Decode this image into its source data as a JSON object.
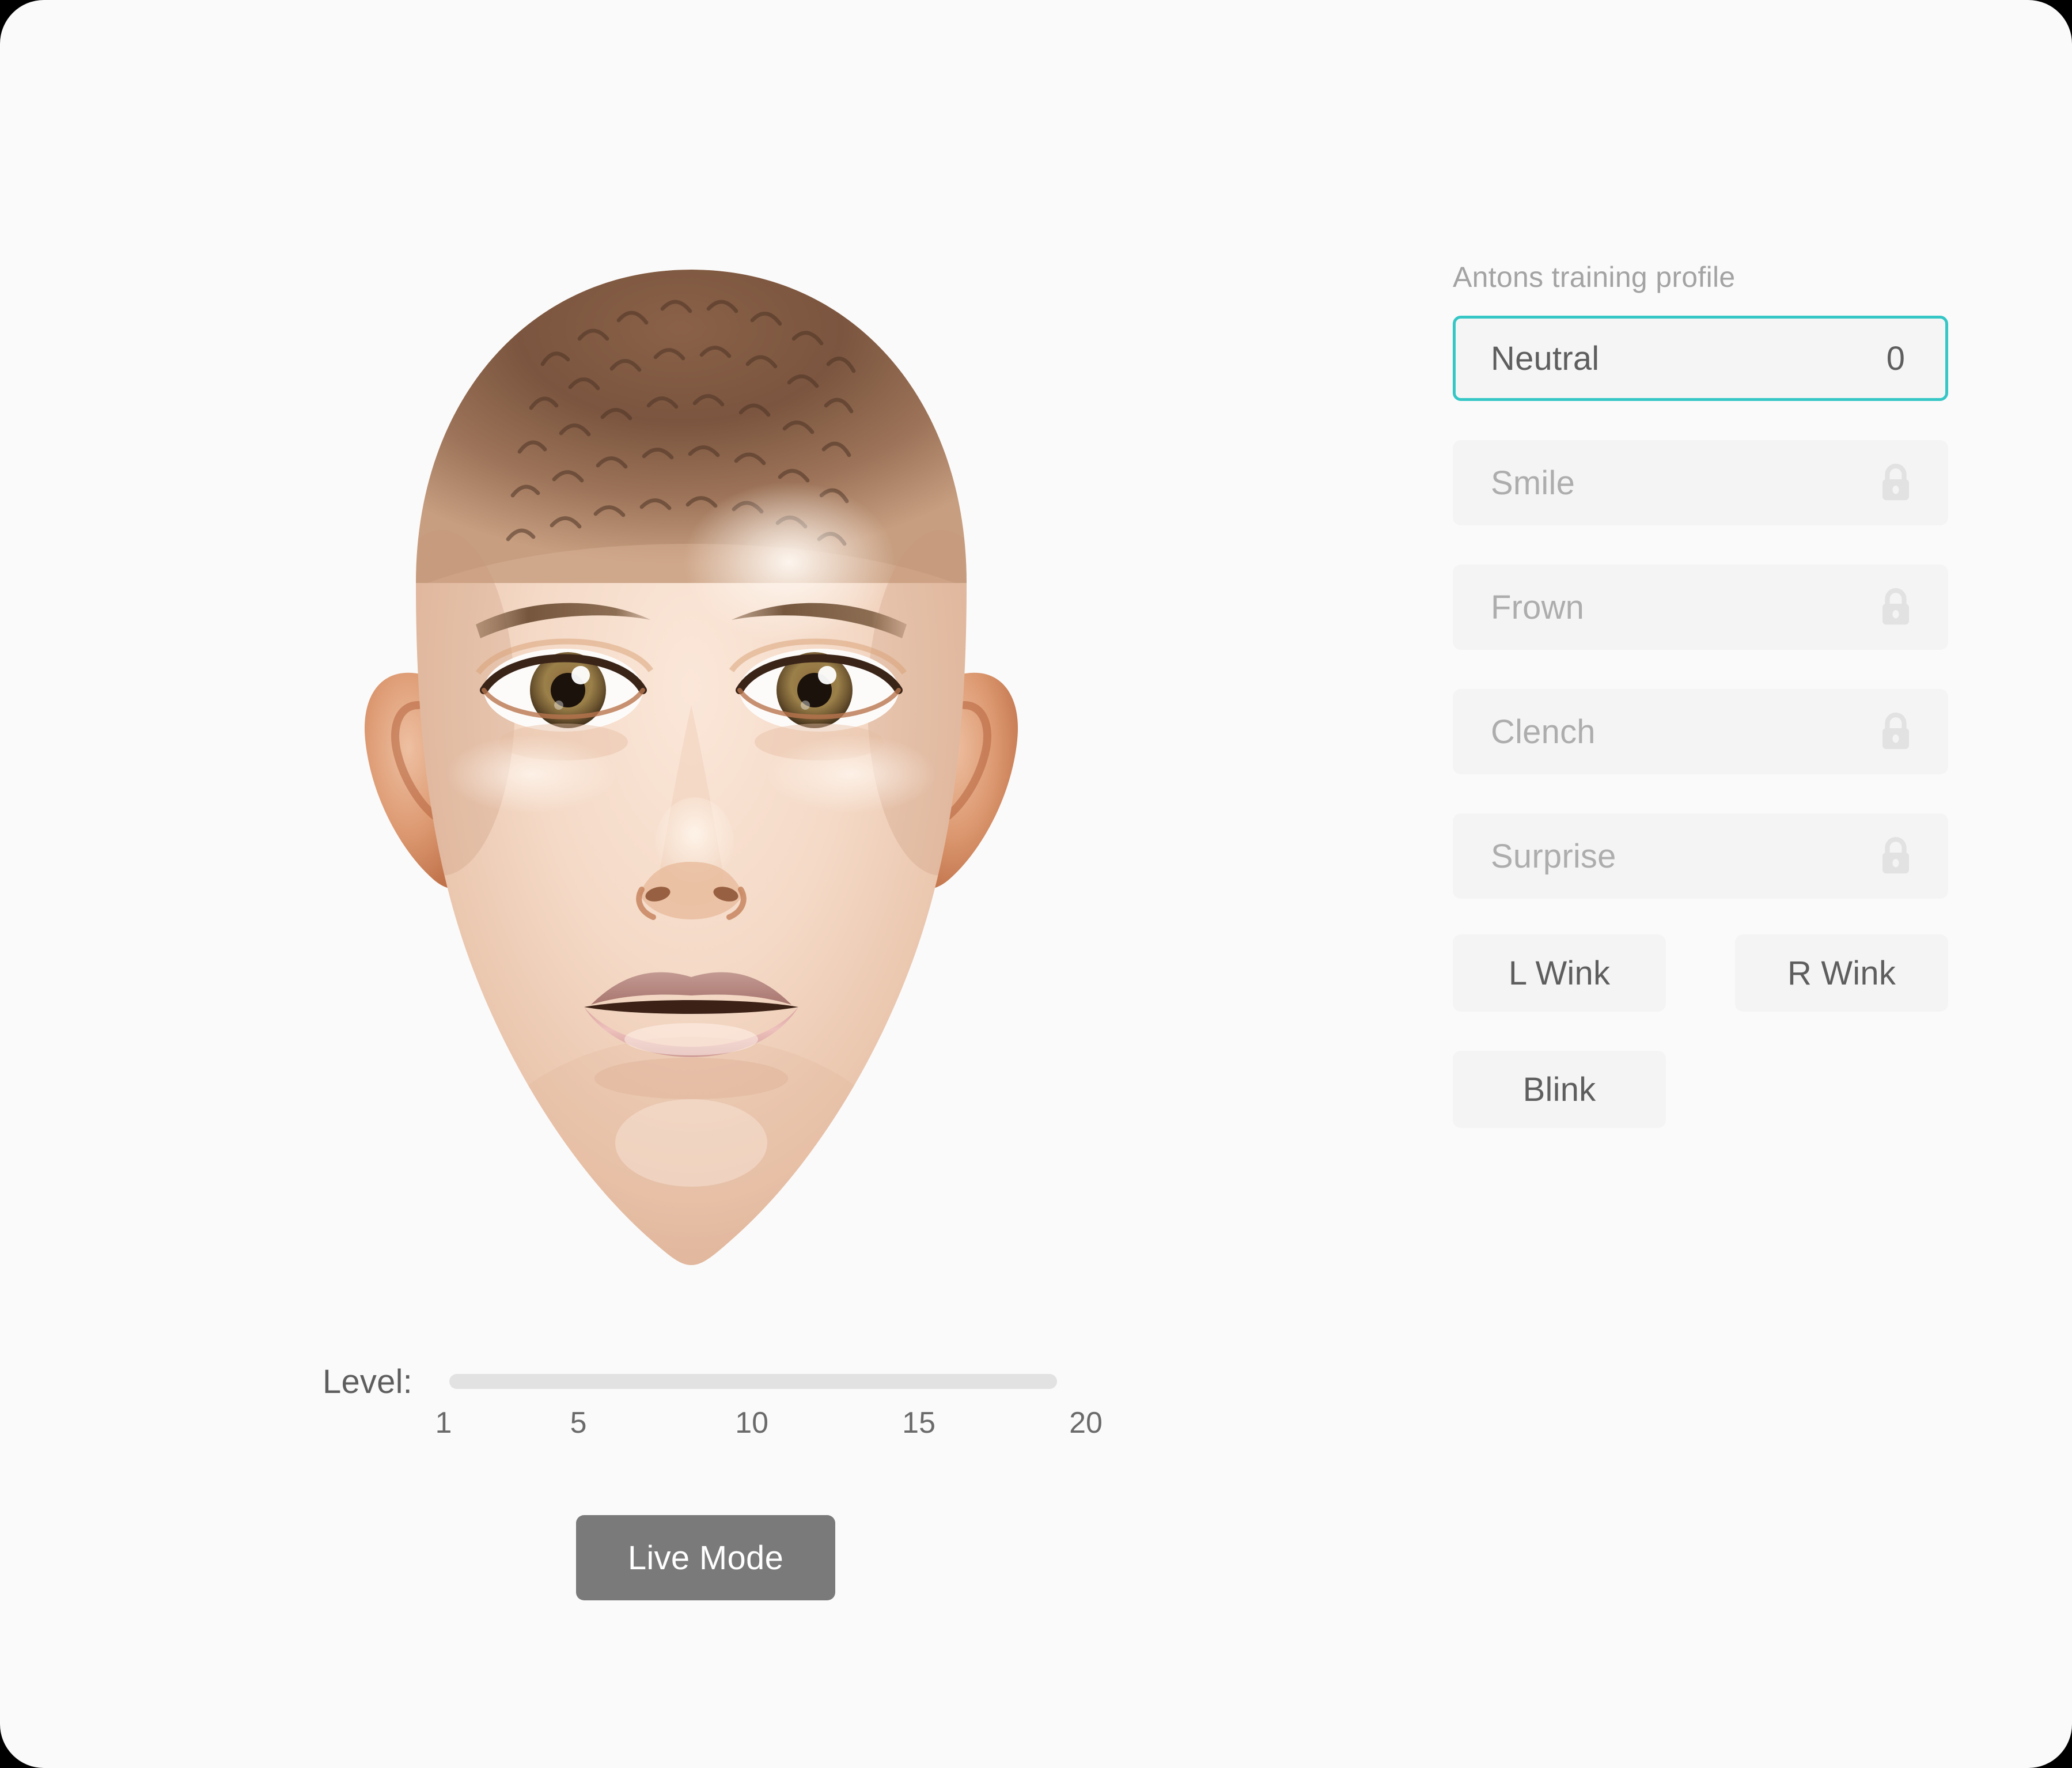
{
  "window": {
    "background": "#000000",
    "surface": "#fafafa",
    "corner_radius_px": 76
  },
  "avatar": {
    "name": "face-avatar",
    "description": "photorealistic 3D rendered front-facing human head, neutral expression, very short cropped dark hair",
    "skin_color": "#f2d6c2",
    "hair_color": "#6b4a38",
    "iris_color": "#a08050",
    "lip_color": "#e2aeae",
    "expression": "Neutral"
  },
  "level_slider": {
    "label": "Level:",
    "value": 0,
    "min": 1,
    "max": 20,
    "fill_percent": 0,
    "track_color": "#e2e2e2",
    "ticks": [
      {
        "label": "1",
        "percent": 0
      },
      {
        "label": "5",
        "percent": 21
      },
      {
        "label": "10",
        "percent": 48
      },
      {
        "label": "15",
        "percent": 74
      },
      {
        "label": "20",
        "percent": 100
      }
    ]
  },
  "live_mode": {
    "label": "Live Mode",
    "background": "#7a7a7a",
    "text_color": "#ffffff"
  },
  "training_panel": {
    "title": "Antons training profile",
    "accent_color": "#35c6c6",
    "expressions": [
      {
        "label": "Neutral",
        "value": "0",
        "locked": false,
        "selected": true
      },
      {
        "label": "Smile",
        "value": "",
        "locked": true,
        "selected": false
      },
      {
        "label": "Frown",
        "value": "",
        "locked": true,
        "selected": false
      },
      {
        "label": "Clench",
        "value": "",
        "locked": true,
        "selected": false
      },
      {
        "label": "Surprise",
        "value": "",
        "locked": true,
        "selected": false
      }
    ],
    "actions": [
      {
        "label": "L Wink"
      },
      {
        "label": "R Wink"
      },
      {
        "label": "Blink"
      }
    ]
  },
  "icons": {
    "lock": "lock-icon"
  }
}
